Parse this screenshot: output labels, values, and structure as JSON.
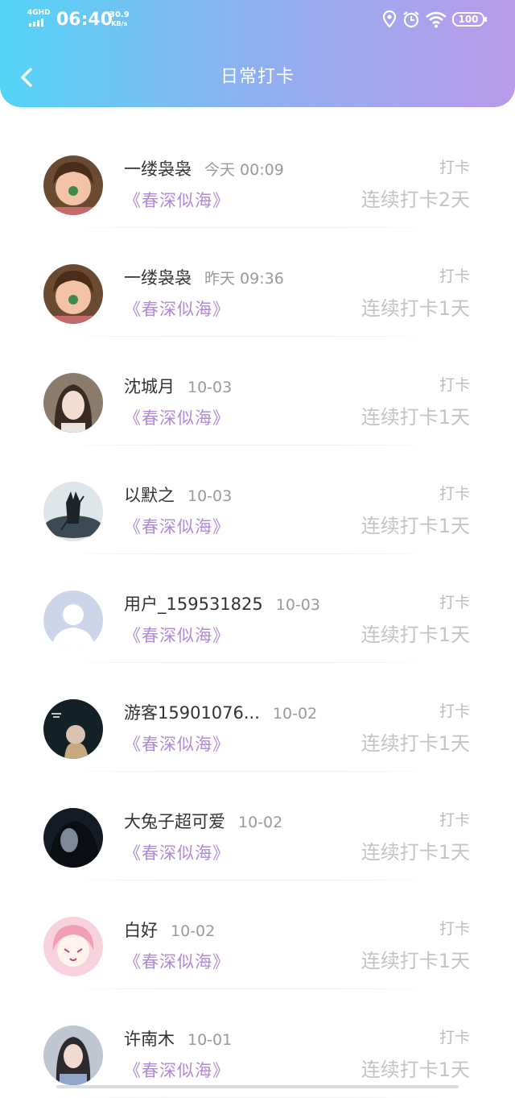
{
  "status_bar": {
    "network": "4GHD",
    "time": "06:40",
    "speed_value": "30.9",
    "speed_unit": "KB/s",
    "battery": "100"
  },
  "header": {
    "title": "日常打卡"
  },
  "checkins": [
    {
      "name": "一缕袅袅",
      "time": "今天 00:09",
      "book": "《春深似海》",
      "tag": "打卡",
      "streak": "连续打卡2天",
      "avatar": "girl-face-photo"
    },
    {
      "name": "一缕袅袅",
      "time": "昨天 09:36",
      "book": "《春深似海》",
      "tag": "打卡",
      "streak": "连续打卡1天",
      "avatar": "girl-face-photo"
    },
    {
      "name": "沈城月",
      "time": "10-03",
      "book": "《春深似海》",
      "tag": "打卡",
      "streak": "连续打卡1天",
      "avatar": "woman-portrait"
    },
    {
      "name": "以默之",
      "time": "10-03",
      "book": "《春深似海》",
      "tag": "打卡",
      "streak": "连续打卡1天",
      "avatar": "warrior-art"
    },
    {
      "name": "用户_159531825",
      "time": "10-03",
      "book": "《春深似海》",
      "tag": "打卡",
      "streak": "连续打卡1天",
      "avatar": "default-user"
    },
    {
      "name": "游客15901076...",
      "time": "10-02",
      "book": "《春深似海》",
      "tag": "打卡",
      "streak": "连续打卡1天",
      "avatar": "dark-poster"
    },
    {
      "name": "大兔子超可爱",
      "time": "10-02",
      "book": "《春深似海》",
      "tag": "打卡",
      "streak": "连续打卡1天",
      "avatar": "dark-portrait"
    },
    {
      "name": "白好",
      "time": "10-02",
      "book": "《春深似海》",
      "tag": "打卡",
      "streak": "连续打卡1天",
      "avatar": "anime-girl"
    },
    {
      "name": "许南木",
      "time": "10-01",
      "book": "《春深似海》",
      "tag": "打卡",
      "streak": "连续打卡1天",
      "avatar": "girl-photo"
    }
  ]
}
